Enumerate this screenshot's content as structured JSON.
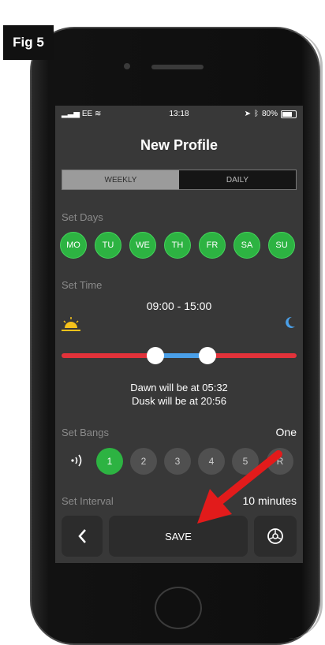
{
  "figure_label": "Fig 5",
  "status": {
    "carrier": "EE",
    "time": "13:18",
    "battery": "80%"
  },
  "title": "New Profile",
  "tabs": [
    {
      "label": "WEEKLY",
      "selected": true
    },
    {
      "label": "DAILY",
      "selected": false
    }
  ],
  "set_days": {
    "label": "Set Days",
    "days": [
      {
        "label": "MO",
        "selected": true
      },
      {
        "label": "TU",
        "selected": true
      },
      {
        "label": "WE",
        "selected": true
      },
      {
        "label": "TH",
        "selected": true
      },
      {
        "label": "FR",
        "selected": true
      },
      {
        "label": "SA",
        "selected": true
      },
      {
        "label": "SU",
        "selected": true
      }
    ]
  },
  "set_time": {
    "label": "Set Time",
    "range": "09:00 - 15:00",
    "dawn": "Dawn will be at 05:32",
    "dusk": "Dusk will be at 20:56"
  },
  "set_bangs": {
    "label": "Set Bangs",
    "value": "One",
    "options": [
      {
        "label": "1",
        "selected": true
      },
      {
        "label": "2",
        "selected": false
      },
      {
        "label": "3",
        "selected": false
      },
      {
        "label": "4",
        "selected": false
      },
      {
        "label": "5",
        "selected": false
      },
      {
        "label": "R",
        "selected": false
      }
    ]
  },
  "set_interval": {
    "label": "Set Interval",
    "value": "10 minutes"
  },
  "buttons": {
    "save": "SAVE"
  },
  "colors": {
    "accent_green": "#2db342",
    "track_red": "#e2323a",
    "track_blue": "#4a9fe8",
    "annotation_arrow": "#e21b1b"
  },
  "icons": [
    "signal-icon",
    "wifi-icon",
    "location-icon",
    "bluetooth-icon",
    "battery-icon",
    "sun-icon",
    "moon-icon",
    "vibrate-icon",
    "back-chevron-icon",
    "gear-icon"
  ]
}
